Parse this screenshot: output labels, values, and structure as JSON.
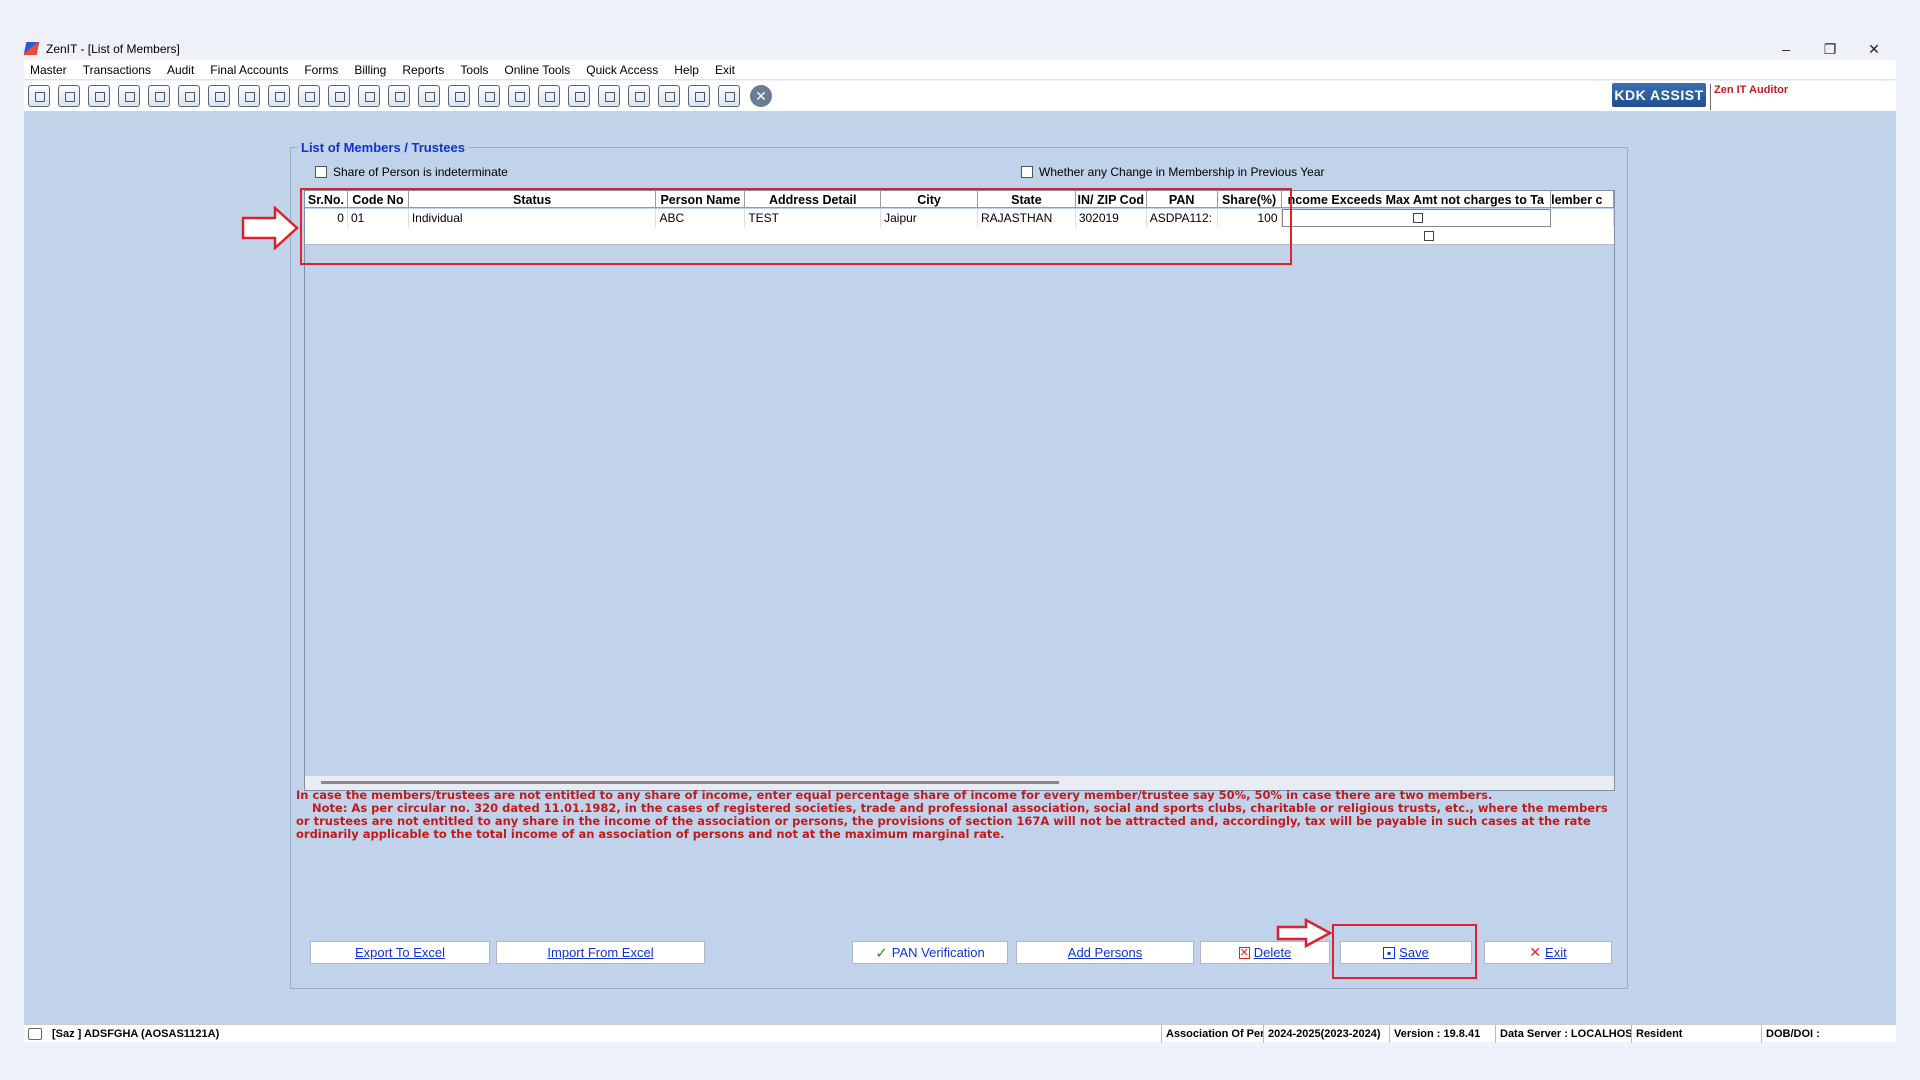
{
  "window": {
    "title": "ZenIT - [List of Members]",
    "minimize": "–",
    "restore": "❐",
    "close": "✕"
  },
  "menu": [
    "Master",
    "Transactions",
    "Audit",
    "Final Accounts",
    "Forms",
    "Billing",
    "Reports",
    "Tools",
    "Online Tools",
    "Quick Access",
    "Help",
    "Exit"
  ],
  "toolbar": {
    "kdk_label": "KDK ASSIST",
    "brand_label": "Zen IT Auditor",
    "close_glyph": "✕"
  },
  "panel": {
    "title": "List of Members / Trustees",
    "chk_indeterminate": "Share of Person is indeterminate",
    "chk_change": "Whether any Change in Membership in Previous Year"
  },
  "grid": {
    "headers": [
      "Sr.No.",
      "Code No",
      "Status",
      "Person Name",
      "Address Detail",
      "City",
      "State",
      "IN/ ZIP Cod",
      "PAN",
      "Share(%)",
      "ncome Exceeds Max Amt not charges to Ta",
      "lember c"
    ],
    "row": {
      "sr": "0",
      "code": "01",
      "status": "Individual",
      "name": "ABC",
      "address": "TEST",
      "city": "Jaipur",
      "state": "RAJASTHAN",
      "zip": "302019",
      "pan": "ASDPA112:",
      "share": "100"
    }
  },
  "notes": {
    "line1": "In case the members/trustees are not entitled to any share of income, enter equal percentage share of income for every member/trustee say 50%, 50% in case there are two members.",
    "line2": "Note: As per circular no. 320 dated 11.01.1982, in the cases of registered societies, trade and professional association, social and sports clubs, charitable or religious trusts, etc., where the members or trustees are not entitled to any share in the income of the association or persons, the provisions of section 167A will not be attracted and, accordingly, tax will be payable in such cases at the rate ordinarily applicable to the total income of an association of persons and not at the maximum marginal rate."
  },
  "buttons": {
    "export": "Export To Excel",
    "import": "Import From Excel",
    "pan": "PAN Verification",
    "add": "Add Persons",
    "delete": "Delete",
    "save": "Save",
    "exit": "Exit"
  },
  "status": {
    "user": "[Saz ] ADSFGHA (AOSAS1121A)",
    "entity": "Association Of Persı",
    "ay": "2024-2025(2023-2024)",
    "version": "Version : 19.8.41",
    "server": "Data Server : LOCALHOST",
    "residency": "Resident",
    "dob": "DOB/DOI :"
  },
  "colors": {
    "workspace": "#c2d4ea",
    "annotation": "#d9232d",
    "note_text": "#c21b1b",
    "title_blue": "#1133cc"
  }
}
